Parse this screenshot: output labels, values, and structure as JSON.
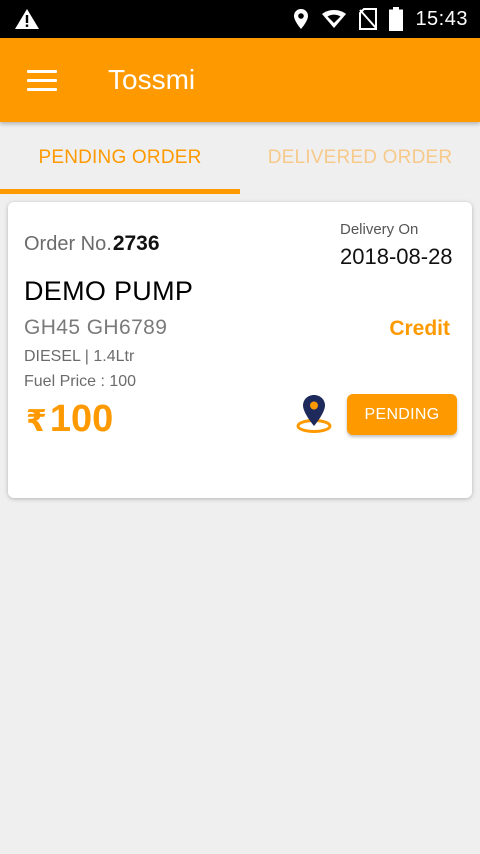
{
  "status_bar": {
    "time": "15:43",
    "icons": [
      "warning-icon",
      "location-icon",
      "wifi-icon",
      "no-sim-icon",
      "battery-icon"
    ]
  },
  "app_bar": {
    "title": "Tossmi",
    "menu_icon": "hamburger-menu-icon",
    "color": "#fe9a00"
  },
  "tabs": [
    {
      "label": "PENDING ORDER",
      "active": true
    },
    {
      "label": "DELIVERED ORDER",
      "active": false
    }
  ],
  "order": {
    "order_no_label": "Order No.",
    "order_no": "2736",
    "delivery_label": "Delivery On",
    "delivery_date": "2018-08-28",
    "pump_name": "DEMO PUMP",
    "vehicle_no": "GH45 GH6789",
    "payment_mode": "Credit",
    "fuel_info": "DIESEL | 1.4Ltr",
    "fuel_price": "Fuel Price : 100",
    "currency_symbol": "₹",
    "amount": "100",
    "status_button": "PENDING",
    "map_icon": "map-pin-icon"
  },
  "colors": {
    "accent": "#fe9a00",
    "accent_light": "#f7c98a",
    "background": "#efefef",
    "pin_navy": "#1f2a5c"
  }
}
